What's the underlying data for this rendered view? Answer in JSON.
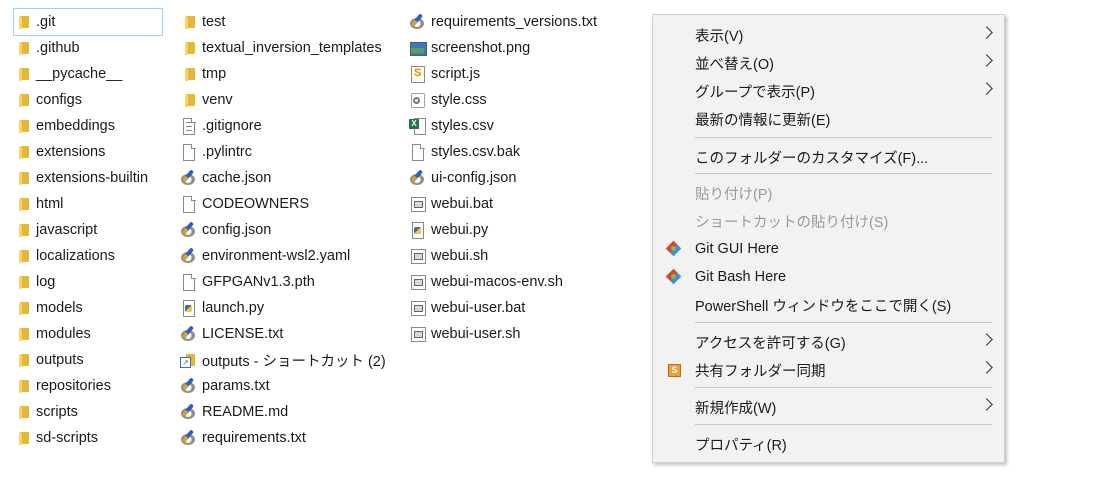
{
  "columns": [
    [
      {
        "name": ".git",
        "icon": "folder-icon",
        "type": "folder",
        "selected": true
      },
      {
        "name": ".github",
        "icon": "folder-icon",
        "type": "folder"
      },
      {
        "name": "__pycache__",
        "icon": "folder-icon",
        "type": "folder"
      },
      {
        "name": "configs",
        "icon": "folder-icon",
        "type": "folder"
      },
      {
        "name": "embeddings",
        "icon": "folder-icon",
        "type": "folder"
      },
      {
        "name": "extensions",
        "icon": "folder-icon",
        "type": "folder"
      },
      {
        "name": "extensions-builtin",
        "icon": "folder-icon",
        "type": "folder"
      },
      {
        "name": "html",
        "icon": "folder-icon",
        "type": "folder"
      },
      {
        "name": "javascript",
        "icon": "folder-icon",
        "type": "folder"
      },
      {
        "name": "localizations",
        "icon": "folder-icon",
        "type": "folder"
      },
      {
        "name": "log",
        "icon": "folder-icon",
        "type": "folder"
      },
      {
        "name": "models",
        "icon": "folder-icon",
        "type": "folder"
      },
      {
        "name": "modules",
        "icon": "folder-icon",
        "type": "folder"
      },
      {
        "name": "outputs",
        "icon": "folder-icon",
        "type": "folder"
      },
      {
        "name": "repositories",
        "icon": "folder-icon",
        "type": "folder"
      },
      {
        "name": "scripts",
        "icon": "folder-icon",
        "type": "folder"
      },
      {
        "name": "sd-scripts",
        "icon": "folder-icon",
        "type": "folder"
      }
    ],
    [
      {
        "name": "test",
        "icon": "folder-icon",
        "type": "folder"
      },
      {
        "name": "textual_inversion_templates",
        "icon": "folder-icon",
        "type": "folder"
      },
      {
        "name": "tmp",
        "icon": "folder-icon",
        "type": "folder"
      },
      {
        "name": "venv",
        "icon": "folder-icon",
        "type": "folder"
      },
      {
        "name": ".gitignore",
        "icon": "text-file-icon",
        "type": "file lines"
      },
      {
        "name": ".pylintrc",
        "icon": "file-icon",
        "type": "file"
      },
      {
        "name": "cache.json",
        "icon": "app-file-icon",
        "type": "app"
      },
      {
        "name": "CODEOWNERS",
        "icon": "file-icon",
        "type": "file"
      },
      {
        "name": "config.json",
        "icon": "app-file-icon",
        "type": "app"
      },
      {
        "name": "environment-wsl2.yaml",
        "icon": "app-file-icon",
        "type": "app"
      },
      {
        "name": "GFPGANv1.3.pth",
        "icon": "file-icon",
        "type": "file"
      },
      {
        "name": "launch.py",
        "icon": "python-file-icon",
        "type": "py"
      },
      {
        "name": "LICENSE.txt",
        "icon": "app-file-icon",
        "type": "app"
      },
      {
        "name": "outputs - ショートカット (2)",
        "icon": "shortcut-icon",
        "type": "short"
      },
      {
        "name": "params.txt",
        "icon": "app-file-icon",
        "type": "app"
      },
      {
        "name": "README.md",
        "icon": "app-file-icon",
        "type": "app"
      },
      {
        "name": "requirements.txt",
        "icon": "app-file-icon",
        "type": "app"
      }
    ],
    [
      {
        "name": "requirements_versions.txt",
        "icon": "app-file-icon",
        "type": "app"
      },
      {
        "name": "screenshot.png",
        "icon": "image-file-icon",
        "type": "img"
      },
      {
        "name": "script.js",
        "icon": "script-file-icon",
        "type": "js"
      },
      {
        "name": "style.css",
        "icon": "css-file-icon",
        "type": "css"
      },
      {
        "name": "styles.csv",
        "icon": "excel-file-icon",
        "type": "xls"
      },
      {
        "name": "styles.csv.bak",
        "icon": "file-icon",
        "type": "file"
      },
      {
        "name": "ui-config.json",
        "icon": "app-file-icon",
        "type": "app"
      },
      {
        "name": "webui.bat",
        "icon": "batch-file-icon",
        "type": "win"
      },
      {
        "name": "webui.py",
        "icon": "python-file-icon",
        "type": "py"
      },
      {
        "name": "webui.sh",
        "icon": "batch-file-icon",
        "type": "win"
      },
      {
        "name": "webui-macos-env.sh",
        "icon": "batch-file-icon",
        "type": "win"
      },
      {
        "name": "webui-user.bat",
        "icon": "batch-file-icon",
        "type": "win"
      },
      {
        "name": "webui-user.sh",
        "icon": "batch-file-icon",
        "type": "win"
      }
    ]
  ],
  "context_menu": {
    "items": [
      {
        "label": "表示(V)",
        "submenu": true
      },
      {
        "label": "並べ替え(O)",
        "submenu": true
      },
      {
        "label": "グループで表示(P)",
        "submenu": true
      },
      {
        "label": "最新の情報に更新(E)"
      },
      {
        "separator": true
      },
      {
        "label": "このフォルダーのカスタマイズ(F)..."
      },
      {
        "separator": true
      },
      {
        "label": "貼り付け(P)",
        "disabled": true
      },
      {
        "label": "ショートカットの貼り付け(S)",
        "disabled": true
      },
      {
        "label": "Git GUI Here",
        "icon": "git-icon"
      },
      {
        "label": "Git Bash Here",
        "icon": "git-icon"
      },
      {
        "label": "PowerShell ウィンドウをここで開く(S)"
      },
      {
        "separator": true
      },
      {
        "label": "アクセスを許可する(G)",
        "submenu": true
      },
      {
        "label": "共有フォルダー同期",
        "icon": "sync-icon",
        "submenu": true
      },
      {
        "separator": true
      },
      {
        "label": "新規作成(W)",
        "submenu": true
      },
      {
        "separator": true
      },
      {
        "label": "プロパティ(R)"
      }
    ]
  }
}
